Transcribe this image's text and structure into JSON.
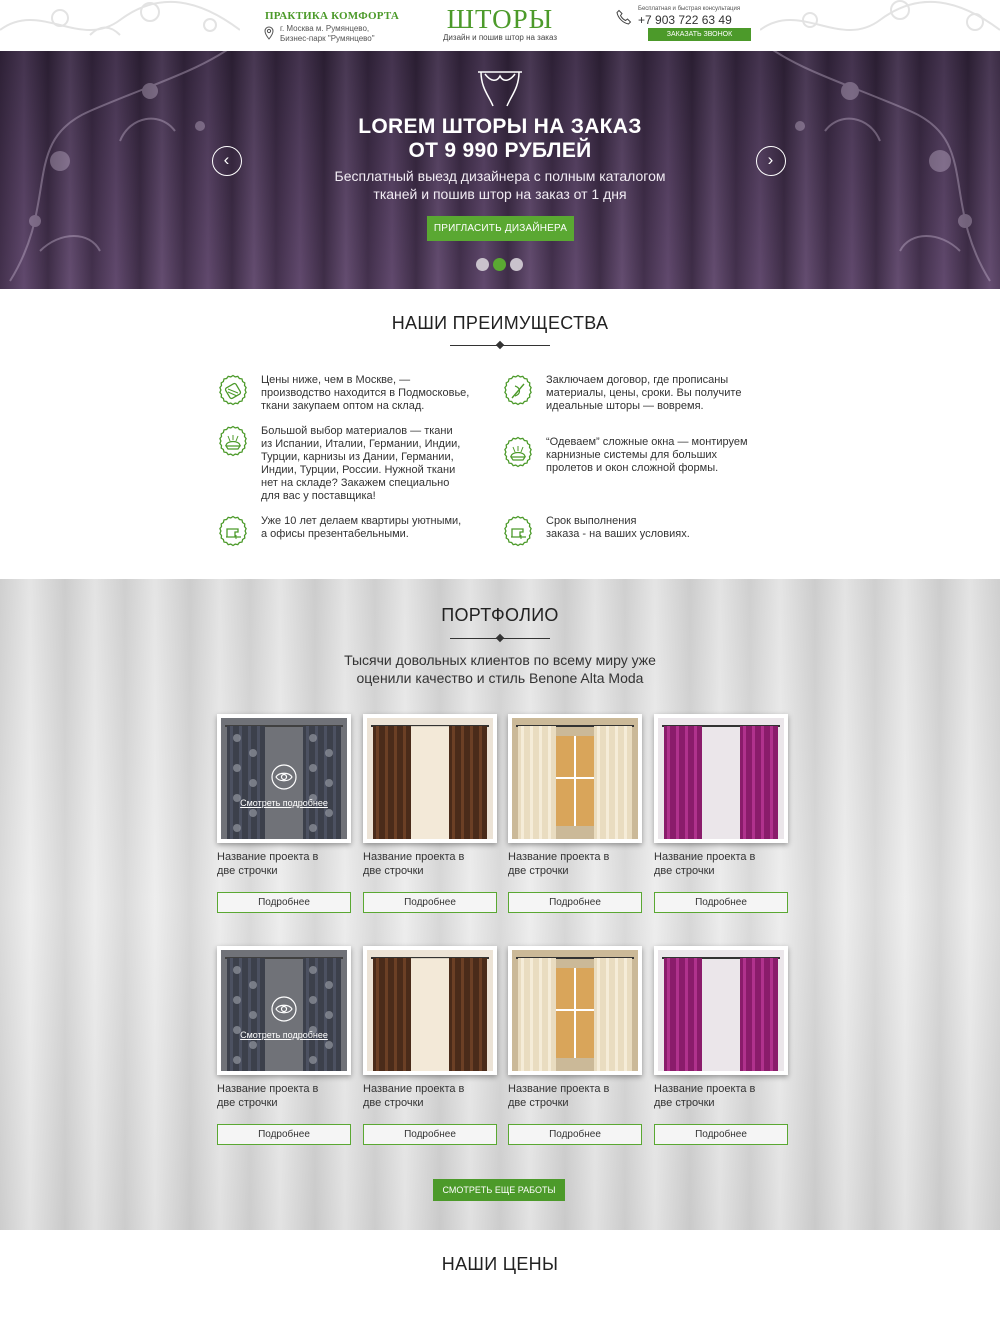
{
  "header": {
    "brand_name": "ПРАКТИКА КОМФОРТА",
    "address_line1": "г. Москва м. Румянцево,",
    "address_line2": "Бизнес-парк \"Румянцево\"",
    "logo_word": "ШТОРЫ",
    "logo_tagline": "Дизайн и пошив штор на заказ",
    "consult_note": "Бесплатная и быстрая консультация",
    "phone": "+7 903 722 63 49",
    "call_button": "ЗАКАЗАТЬ ЗВОНОК",
    "accent_color": "#4c9a2a"
  },
  "hero": {
    "title_line1": "LOREM ШТОРЫ НА ЗАКАЗ",
    "title_line2": "ОТ 9 990 РУБЛЕЙ",
    "subtitle_line1": "Бесплатный выезд дизайнера с полным каталогом",
    "subtitle_line2": "тканей и пошив штор на заказ от 1 дня",
    "cta_button": "ПРИГЛАСИТЬ ДИЗАЙНЕРА",
    "prev_arrow": "‹",
    "next_arrow": "›",
    "slides_count": 3,
    "active_slide": 2
  },
  "advantages": {
    "title": "НАШИ ПРЕИМУЩЕСТВА",
    "items": [
      {
        "icon": "thread-spool-icon",
        "lines": [
          "Цены ниже, чем в Москве, —",
          "производство находится в Подмосковье,",
          "ткани закупаем оптом на склад."
        ]
      },
      {
        "icon": "needle-thread-icon",
        "lines": [
          "Заключаем договор, где прописаны",
          "материалы, цены, сроки. Вы получите",
          "идеальные шторы — вовремя."
        ]
      },
      {
        "icon": "pincushion-icon",
        "lines": [
          "Большой выбор материалов — ткани",
          "из Испании, Италии, Германии, Индии,",
          "Турции, карнизы из Дании, Германии,",
          "Индии, Турции, России. Нужной ткани",
          "нет на складе? Закажем специально",
          "для вас у поставщика!"
        ]
      },
      {
        "icon": "pincushion-icon",
        "lines": [
          "“Одеваем” сложные окна — монтируем",
          "карнизные системы для больших",
          "пролетов и окон сложной формы."
        ]
      },
      {
        "icon": "sewing-machine-icon",
        "lines": [
          "Уже 10 лет делаем квартиры уютными,",
          "а офисы презентабельными."
        ]
      },
      {
        "icon": "sewing-machine-icon",
        "lines": [
          "Срок выполнения",
          "заказа - на ваших условиях."
        ]
      }
    ]
  },
  "portfolio": {
    "title": "ПОРТФОЛИО",
    "lead_line1": "Тысячи довольных клиентов по всему миру уже",
    "lead_line2": "оценили качество и стиль Benone Alta Moda",
    "overlay_label": "Смотреть подробнее",
    "projects": [
      {
        "name_line1": "Название проекта в",
        "name_line2": "две строчки",
        "button": "Подробнее",
        "style": "dark-pattern"
      },
      {
        "name_line1": "Название проекта в",
        "name_line2": "две строчки",
        "button": "Подробнее",
        "style": "brown"
      },
      {
        "name_line1": "Название проекта в",
        "name_line2": "две строчки",
        "button": "Подробнее",
        "style": "cream"
      },
      {
        "name_line1": "Название проекта в",
        "name_line2": "две строчки",
        "button": "Подробнее",
        "style": "magenta"
      },
      {
        "name_line1": "Название проекта в",
        "name_line2": "две строчки",
        "button": "Подробнее",
        "style": "dark-pattern"
      },
      {
        "name_line1": "Название проекта в",
        "name_line2": "две строчки",
        "button": "Подробнее",
        "style": "brown"
      },
      {
        "name_line1": "Название проекта в",
        "name_line2": "две строчки",
        "button": "Подробнее",
        "style": "cream"
      },
      {
        "name_line1": "Название проекта в",
        "name_line2": "две строчки",
        "button": "Подробнее",
        "style": "magenta"
      }
    ],
    "more_works_button": "СМОТРЕТЬ ЕЩЕ РАБОТЫ"
  },
  "prices": {
    "title": "НАШИ ЦЕНЫ"
  }
}
